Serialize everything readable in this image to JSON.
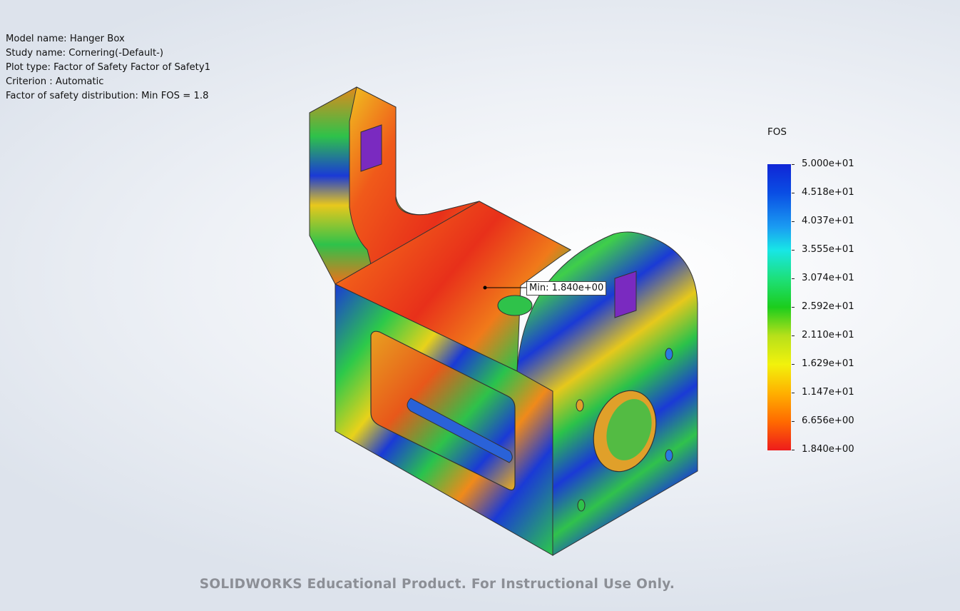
{
  "header": {
    "model_name": "Model name: Hanger Box",
    "study_name": "Study name: Cornering(-Default-)",
    "plot_type": "Plot type: Factor of Safety Factor of Safety1",
    "criterion": "Criterion : Automatic",
    "fos_distribution": "Factor of safety distribution: Min FOS = 1.8"
  },
  "legend": {
    "title": "FOS",
    "colormap": [
      "#1026d6",
      "#1a9cf2",
      "#18e6e6",
      "#1ccd1c",
      "#f2f20c",
      "#ff6a00",
      "#ee1c1c"
    ],
    "ticks": [
      "5.000e+01",
      "4.518e+01",
      "4.037e+01",
      "3.555e+01",
      "3.074e+01",
      "2.592e+01",
      "2.110e+01",
      "1.629e+01",
      "1.147e+01",
      "6.656e+00",
      "1.840e+00"
    ]
  },
  "min_marker": {
    "label": "Min: 1.840e+00"
  },
  "footer": {
    "watermark": "SOLIDWORKS Educational Product. For Instructional Use Only."
  }
}
